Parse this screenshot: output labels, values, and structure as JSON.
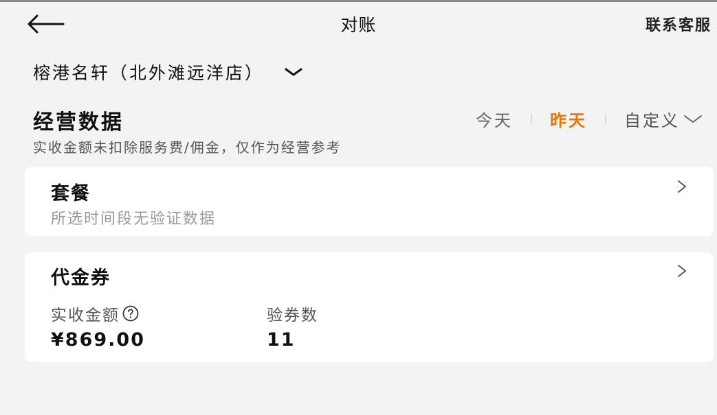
{
  "nav": {
    "back_icon": "back-arrow-icon",
    "title": "对账",
    "service_label": "联系客服"
  },
  "store": {
    "name": "榕港名轩（北外滩远洋店）",
    "dropdown_icon": "chevron-down-icon"
  },
  "business": {
    "title": "经营数据",
    "subtitle": "实收金额未扣除服务费/佣金，仅作为经营参考",
    "date_tabs": [
      "今天",
      "昨天",
      "自定义"
    ],
    "active_tab": "昨天",
    "active_color": "#f07300"
  },
  "cards": {
    "package": {
      "title": "套餐",
      "empty_text": "所选时间段无验证数据"
    },
    "voucher": {
      "title": "代金券",
      "revenue_label": "实收金额",
      "revenue_value": "¥869.00",
      "count_label": "验券数",
      "count_value": "11"
    }
  }
}
